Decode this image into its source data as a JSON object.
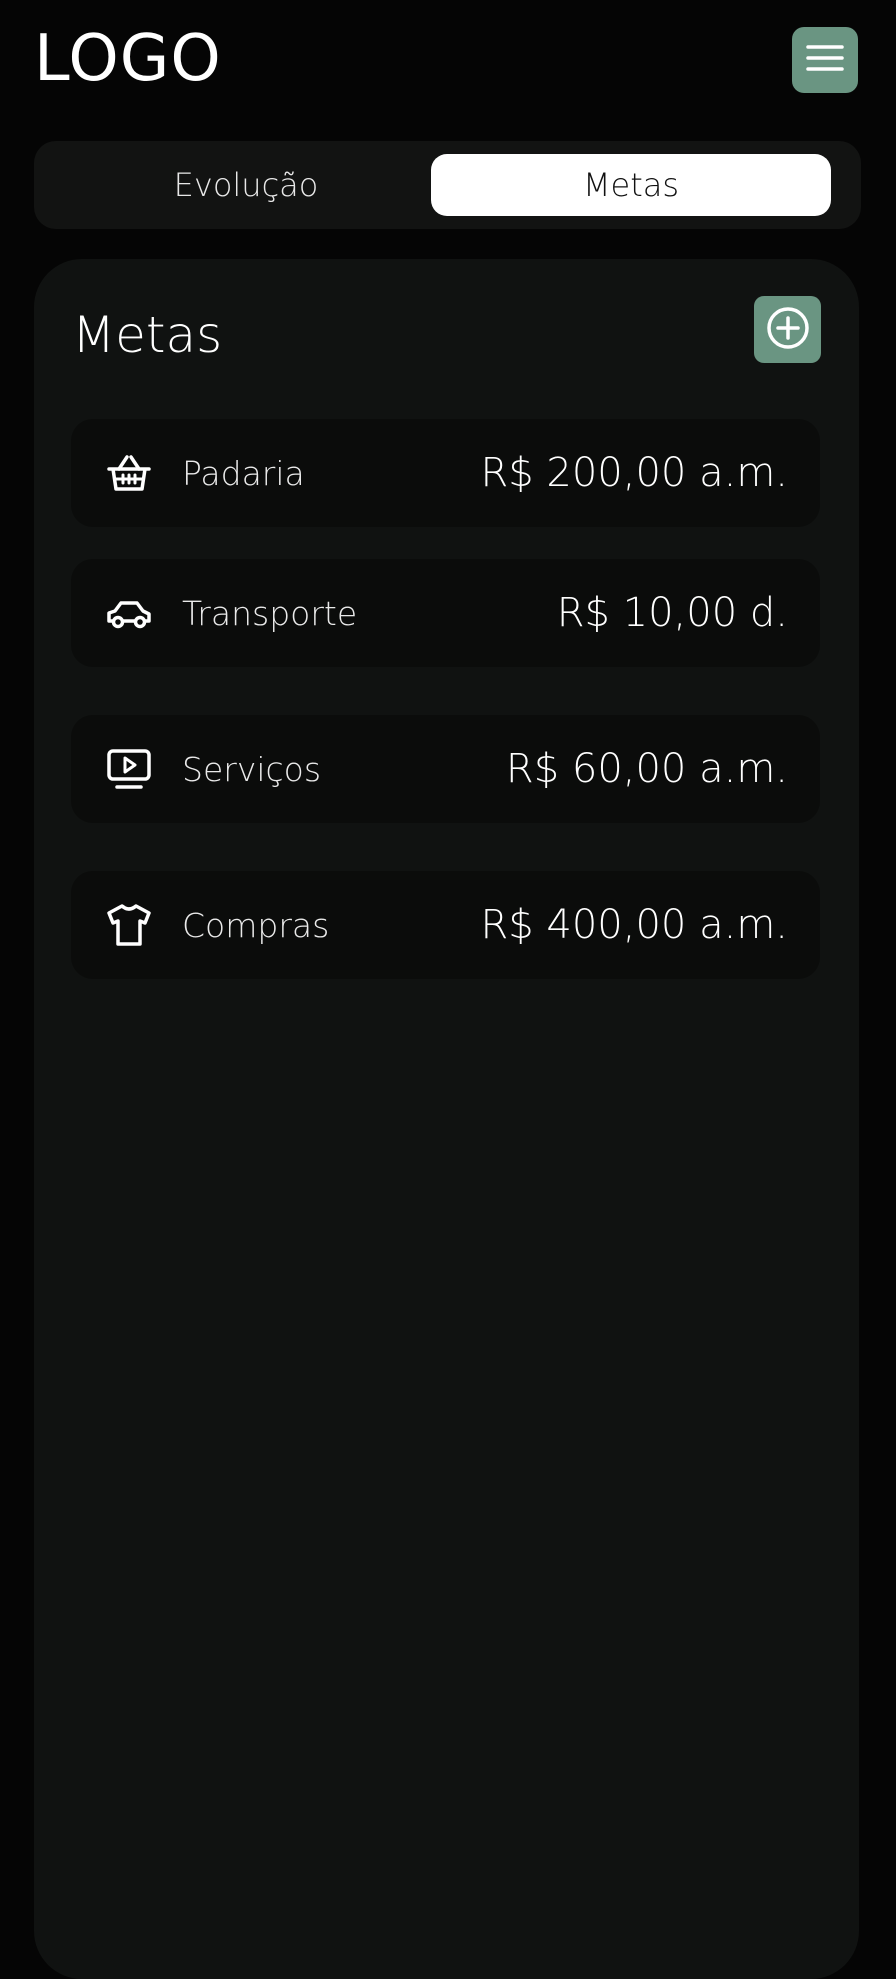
{
  "header": {
    "logo": "LOGO",
    "menu_icon": "hamburger-menu-icon",
    "accent_color": "#6a9582"
  },
  "tabs": [
    {
      "label": "Evolução",
      "active": false
    },
    {
      "label": "Metas",
      "active": true
    }
  ],
  "panel": {
    "title": "Metas",
    "add_icon": "plus-circle-icon",
    "goals": [
      {
        "label": "Padaria",
        "value": "R$ 200,00 a.m.",
        "icon": "basket-icon"
      },
      {
        "label": "Transporte",
        "value": "R$ 10,00 d.",
        "icon": "car-icon"
      },
      {
        "label": "Serviços",
        "value": "R$ 60,00 a.m.",
        "icon": "tv-play-icon"
      },
      {
        "label": "Compras",
        "value": "R$ 400,00 a.m.",
        "icon": "tshirt-icon"
      }
    ]
  }
}
